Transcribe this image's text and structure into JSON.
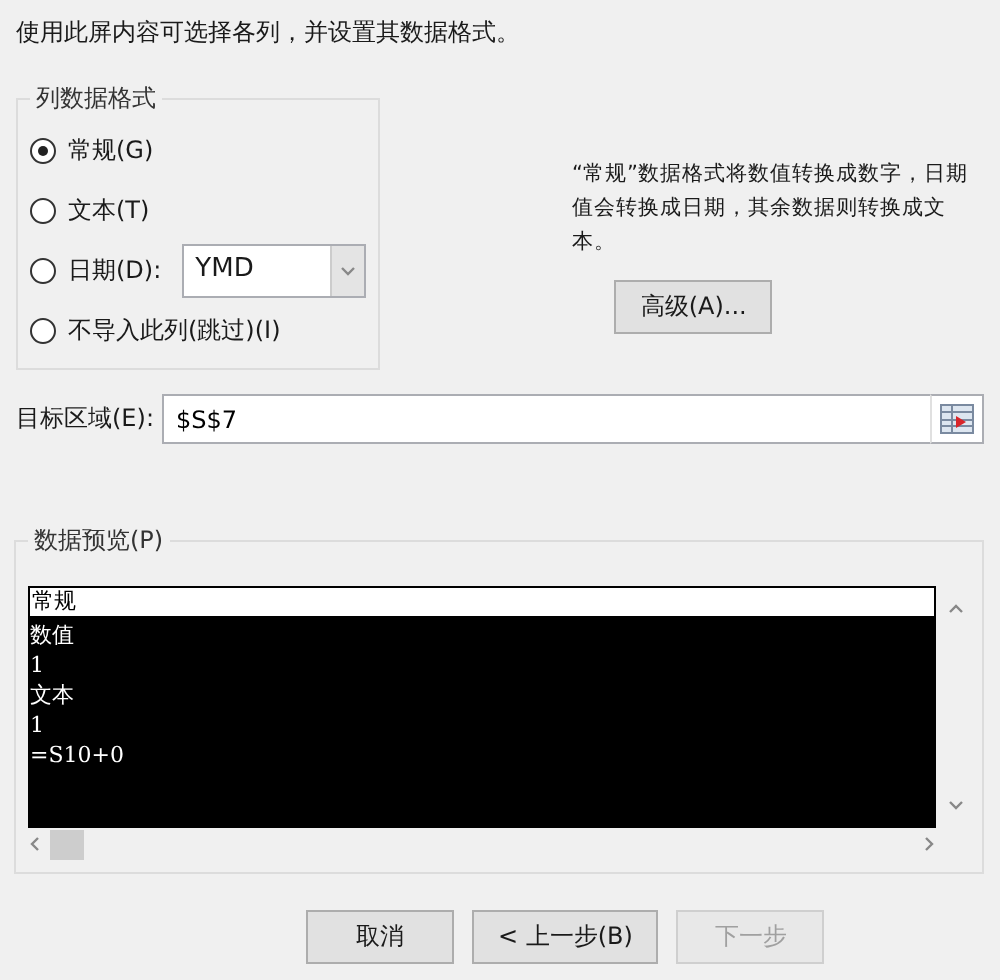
{
  "instruction": "使用此屏内容可选择各列，并设置其数据格式。",
  "column_format": {
    "title": "列数据格式",
    "options": [
      {
        "label": "常规(G)",
        "selected": true,
        "kind": "plain"
      },
      {
        "label": "文本(T)",
        "selected": false,
        "kind": "plain"
      },
      {
        "label": "日期(D):",
        "selected": false,
        "kind": "date"
      },
      {
        "label": "不导入此列(跳过)(I)",
        "selected": false,
        "kind": "plain"
      }
    ],
    "date_value": "YMD"
  },
  "description": "“常规”数据格式将数值转换成数字，日期值会转换成日期，其余数据则转换成文本。",
  "advanced_button": "高级(A)...",
  "destination": {
    "label": "目标区域(E):",
    "value": "$S$7"
  },
  "preview": {
    "title": "数据预览(P)",
    "header": "常规",
    "rows": [
      "数值",
      "1",
      "文本",
      "1",
      "=S10+0"
    ]
  },
  "buttons": [
    {
      "label": "取消",
      "disabled": false
    },
    {
      "label": "< 上一步(B)",
      "disabled": false
    },
    {
      "label": "下一步",
      "disabled": true
    }
  ]
}
